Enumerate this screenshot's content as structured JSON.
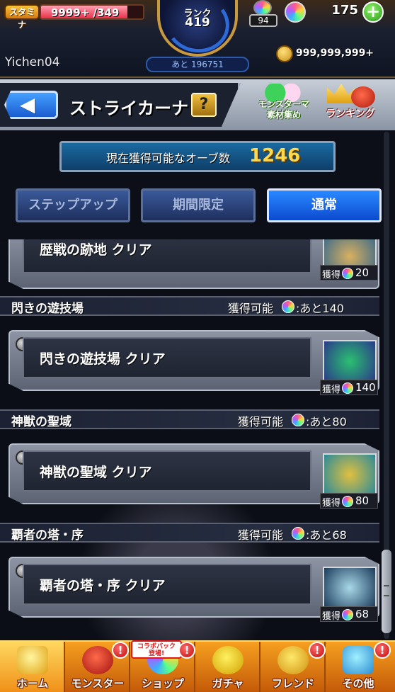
{
  "status_bar": {
    "stamina_label": "スタミナ",
    "stamina_text": "9999+ /349",
    "stamina_fill_ratio": 0.85,
    "rank_label": "ランク",
    "rank_value": "419",
    "next_exp": "あと 196751",
    "pack_count": "94",
    "orb_count": "175",
    "add_orb_symbol": "+",
    "username": "Yichen04",
    "gold": "999,999,999+"
  },
  "header": {
    "back_icon": "◀",
    "title": "ストライカーナビ",
    "help_symbol": "?",
    "materials_label_line1": "モンスターマ",
    "materials_label_line2": "素材集め",
    "ranking_label": "ランキング"
  },
  "orb_banner": {
    "label": "現在獲得可能なオーブ数",
    "value": "1246"
  },
  "tabs": [
    {
      "label": "ステップアップ"
    },
    {
      "label": "期間限定"
    },
    {
      "label": "通常"
    }
  ],
  "sections": [
    {
      "title": "",
      "mission": "歴戦の跡地 クリア",
      "reward_label": "獲得",
      "reward_value": "20"
    },
    {
      "title": "閃きの遊技場",
      "avail_label": "獲得可能",
      "remaining": ":あと140",
      "mission": "閃きの遊技場 クリア",
      "reward_label": "獲得",
      "reward_value": "140"
    },
    {
      "title": "神獣の聖域",
      "avail_label": "獲得可能",
      "remaining": ":あと80",
      "mission": "神獣の聖域 クリア",
      "reward_label": "獲得",
      "reward_value": "80"
    },
    {
      "title": "覇者の塔・序",
      "avail_label": "獲得可能",
      "remaining": ":あと68",
      "mission": "覇者の塔・序 クリア",
      "reward_label": "獲得",
      "reward_value": "68"
    }
  ],
  "bottom_nav": {
    "collab_tag_line1": "コラボパック",
    "collab_tag_line2": "登場!",
    "badge_symbol": "!",
    "items": [
      {
        "label": "ホーム"
      },
      {
        "label": "モンスター"
      },
      {
        "label": "ショップ"
      },
      {
        "label": "ガチャ"
      },
      {
        "label": "フレンド"
      },
      {
        "label": "その他"
      }
    ]
  },
  "colors": {
    "tab_active": "#1a6ae8",
    "orb_value": "#ffd84a",
    "nav_bg": "#f08a18"
  }
}
